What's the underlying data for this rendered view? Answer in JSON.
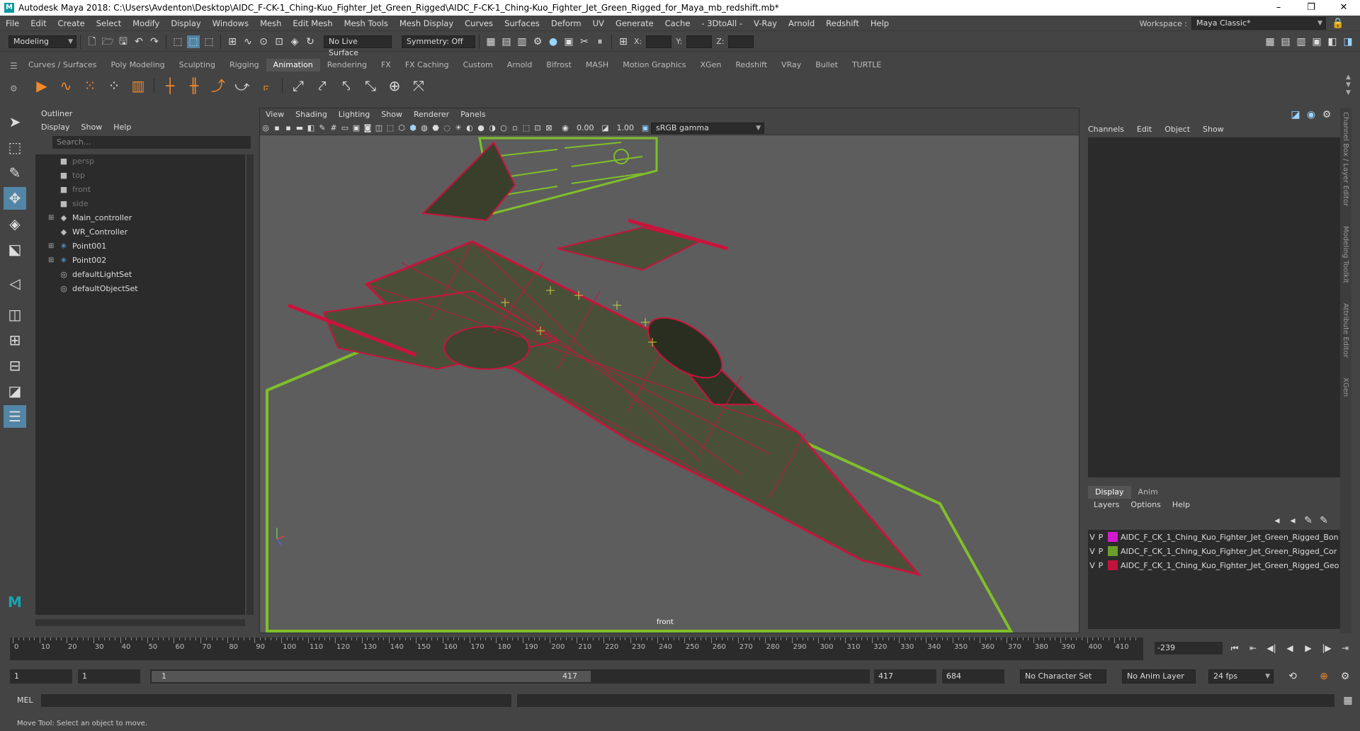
{
  "window": {
    "title": "Autodesk Maya 2018: C:\\Users\\Avdenton\\Desktop\\AIDC_F-CK-1_Ching-Kuo_Fighter_Jet_Green_Rigged\\AIDC_F-CK-1_Ching-Kuo_Fighter_Jet_Green_Rigged_for_Maya_mb_redshift.mb*",
    "logo": "M",
    "controls": [
      "–",
      "❐",
      "✕"
    ]
  },
  "menubar": {
    "items": [
      "File",
      "Edit",
      "Create",
      "Select",
      "Modify",
      "Display",
      "Windows",
      "Mesh",
      "Edit Mesh",
      "Mesh Tools",
      "Mesh Display",
      "Curves",
      "Surfaces",
      "Deform",
      "UV",
      "Generate",
      "Cache",
      "- 3DtoAll -",
      "V-Ray",
      "Arnold",
      "Redshift",
      "Help"
    ],
    "workspace_label": "Workspace :",
    "workspace_value": "Maya Classic*"
  },
  "statusline": {
    "mode": "Modeling",
    "live_surface": "No Live Surface",
    "symmetry": "Symmetry: Off",
    "x_label": "X:",
    "y_label": "Y:",
    "z_label": "Z:"
  },
  "shelf": {
    "tabs": [
      "Curves / Surfaces",
      "Poly Modeling",
      "Sculpting",
      "Rigging",
      "Animation",
      "Rendering",
      "FX",
      "FX Caching",
      "Custom",
      "Arnold",
      "Bifrost",
      "MASH",
      "Motion Graphics",
      "XGen",
      "Redshift",
      "VRay",
      "Bullet",
      "TURTLE"
    ],
    "active_tab": "Animation"
  },
  "outliner": {
    "title": "Outliner",
    "menu": [
      "Display",
      "Show",
      "Help"
    ],
    "search_placeholder": "Search...",
    "items": [
      {
        "label": "persp",
        "dim": true,
        "expandable": false,
        "icon": "camera-icon"
      },
      {
        "label": "top",
        "dim": true,
        "expandable": false,
        "icon": "camera-icon"
      },
      {
        "label": "front",
        "dim": true,
        "expandable": false,
        "icon": "camera-icon"
      },
      {
        "label": "side",
        "dim": true,
        "expandable": false,
        "icon": "camera-icon"
      },
      {
        "label": "Main_controller",
        "dim": false,
        "expandable": true,
        "icon": "transform-icon"
      },
      {
        "label": "WR_Controller",
        "dim": false,
        "expandable": false,
        "icon": "transform-icon"
      },
      {
        "label": "Point001",
        "dim": false,
        "expandable": true,
        "icon": "light-icon"
      },
      {
        "label": "Point002",
        "dim": false,
        "expandable": true,
        "icon": "light-icon"
      },
      {
        "label": "defaultLightSet",
        "dim": false,
        "expandable": false,
        "icon": "set-icon"
      },
      {
        "label": "defaultObjectSet",
        "dim": false,
        "expandable": false,
        "icon": "set-icon"
      }
    ]
  },
  "viewport": {
    "menu": [
      "View",
      "Shading",
      "Lighting",
      "Show",
      "Renderer",
      "Panels"
    ],
    "exposure": "0.00",
    "gamma": "1.00",
    "color_space": "sRGB gamma",
    "camera_label": "front"
  },
  "channelbox": {
    "menu": [
      "Channels",
      "Edit",
      "Object",
      "Show"
    ],
    "side_tabs": [
      "Channel Box / Layer Editor",
      "Modeling Toolkit",
      "Attribute Editor",
      "XGen"
    ]
  },
  "layer_editor": {
    "tabs": [
      "Display",
      "Anim"
    ],
    "active_tab": "Display",
    "menu": [
      "Layers",
      "Options",
      "Help"
    ],
    "layers": [
      {
        "v": "V",
        "p": "P",
        "color": "#d01ad0",
        "name": "AIDC_F_CK_1_Ching_Kuo_Fighter_Jet_Green_Rigged_Bon"
      },
      {
        "v": "V",
        "p": "P",
        "color": "#6aa02a",
        "name": "AIDC_F_CK_1_Ching_Kuo_Fighter_Jet_Green_Rigged_Cor"
      },
      {
        "v": "V",
        "p": "P",
        "color": "#c0143a",
        "name": "AIDC_F_CK_1_Ching_Kuo_Fighter_Jet_Green_Rigged_Geo"
      }
    ]
  },
  "timeline": {
    "ticks": [
      "0",
      "10",
      "20",
      "30",
      "40",
      "50",
      "60",
      "70",
      "80",
      "90",
      "100",
      "110",
      "120",
      "130",
      "140",
      "150",
      "160",
      "170",
      "180",
      "190",
      "200",
      "210",
      "220",
      "230",
      "240",
      "250",
      "260",
      "270",
      "280",
      "290",
      "300",
      "310",
      "320",
      "330",
      "340",
      "350",
      "360",
      "370",
      "380",
      "390",
      "400",
      "410"
    ],
    "current_frame": "-239"
  },
  "range": {
    "start": "1",
    "playback_start": "1",
    "slider_start": "1",
    "slider_end": "417",
    "playback_end": "417",
    "end": "684",
    "character_set": "No Character Set",
    "anim_layer": "No Anim Layer",
    "fps": "24 fps"
  },
  "command": {
    "label": "MEL"
  },
  "helpline": {
    "text": "Move Tool: Select an object to move."
  },
  "colors": {
    "wireframe": "#c8143c",
    "controller": "#7fbf2a",
    "active_tab": "#545454",
    "tool_active": "#5285a6"
  }
}
